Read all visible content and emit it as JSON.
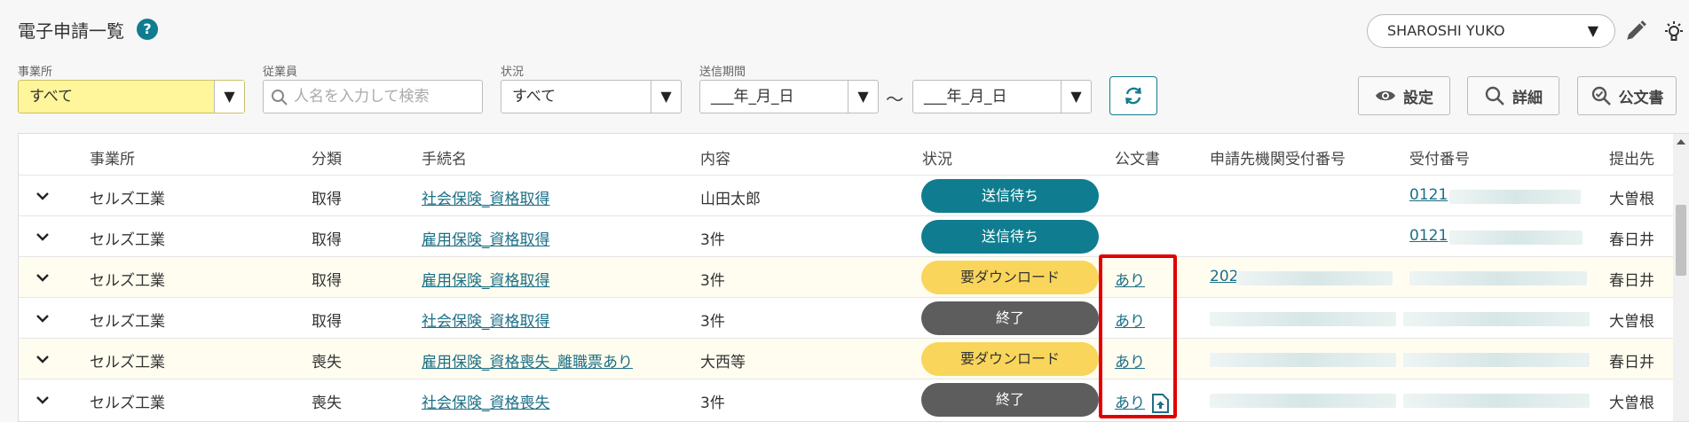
{
  "header": {
    "title": "電子申請一覧",
    "help": "?",
    "user": "SHAROSHI YUKO"
  },
  "filters": {
    "office_label": "事業所",
    "office_value": "すべて",
    "employee_label": "従業員",
    "employee_placeholder": "人名を入力して検索",
    "status_label": "状況",
    "status_value": "すべて",
    "period_label": "送信期間",
    "period_from": "___年_月_日",
    "period_to": "___年_月_日",
    "tilde": "～"
  },
  "toolbar": {
    "settings": "設定",
    "details": "詳細",
    "official": "公文書"
  },
  "table": {
    "columns": [
      "事業所",
      "分類",
      "手続名",
      "内容",
      "状況",
      "公文書",
      "申請先機関受付番号",
      "受付番号",
      "提出先"
    ],
    "rows": [
      {
        "office": "セルズ工業",
        "category": "取得",
        "procedure": "社会保険_資格取得",
        "content": "山田太郎",
        "status": "送信待ち",
        "official": "",
        "agency_no": "",
        "receipt_no": "0121",
        "dest": "大曽根"
      },
      {
        "office": "セルズ工業",
        "category": "取得",
        "procedure": "雇用保険_資格取得",
        "content": "3件",
        "status": "送信待ち",
        "official": "",
        "agency_no": "",
        "receipt_no": "0121",
        "dest": "春日井"
      },
      {
        "office": "セルズ工業",
        "category": "取得",
        "procedure": "雇用保険_資格取得",
        "content": "3件",
        "status": "要ダウンロード",
        "official": "あり",
        "agency_no": "202",
        "receipt_no": "",
        "dest": "春日井"
      },
      {
        "office": "セルズ工業",
        "category": "取得",
        "procedure": "社会保険_資格取得",
        "content": "3件",
        "status": "終了",
        "official": "あり",
        "agency_no": "",
        "receipt_no": "",
        "dest": "大曽根"
      },
      {
        "office": "セルズ工業",
        "category": "喪失",
        "procedure": "雇用保険_資格喪失_離職票あり",
        "content": "大西等",
        "status": "要ダウンロード",
        "official": "あり",
        "agency_no": "",
        "receipt_no": "",
        "dest": "春日井"
      },
      {
        "office": "セルズ工業",
        "category": "喪失",
        "procedure": "社会保険_資格喪失",
        "content": "3件",
        "status": "終了",
        "official": "あり",
        "agency_no": "",
        "receipt_no": "",
        "dest": "大曽根"
      }
    ]
  },
  "colors": {
    "accent": "#0f7d8f",
    "pending": "#f9d55b",
    "done": "#5d5d5d",
    "highlight": "#e10000"
  }
}
